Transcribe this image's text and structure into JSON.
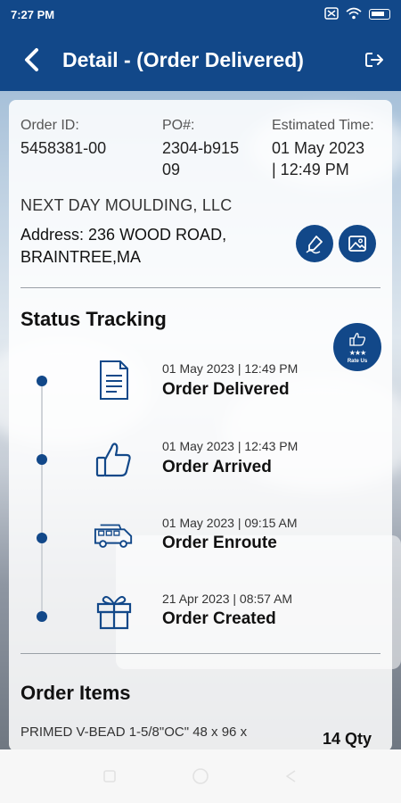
{
  "status_bar": {
    "time": "7:27 PM"
  },
  "app_bar": {
    "title": "Detail - (Order Delivered)"
  },
  "order": {
    "id_label": "Order ID:",
    "id_value": "5458381-00",
    "po_label": "PO#:",
    "po_value_line1": "2304-b915",
    "po_value_line2": "09",
    "eta_label": "Estimated Time:",
    "eta_value_line1": "01 May 2023",
    "eta_value_line2": "| 12:49 PM",
    "company": "NEXT DAY MOULDING, LLC",
    "address_line1": "Address: 236 WOOD ROAD,",
    "address_line2": "BRAINTREE,MA"
  },
  "status_tracking": {
    "title": "Status Tracking",
    "rate_label": "Rate Us",
    "steps": [
      {
        "time": "01 May 2023 | 12:49 PM",
        "title": "Order Delivered",
        "icon": "document-icon"
      },
      {
        "time": "01 May 2023 | 12:43 PM",
        "title": "Order Arrived",
        "icon": "thumbs-up-icon"
      },
      {
        "time": "01 May 2023 | 09:15 AM",
        "title": "Order Enroute",
        "icon": "truck-icon"
      },
      {
        "time": "21 Apr 2023 | 08:57 AM",
        "title": "Order Created",
        "icon": "gift-icon"
      }
    ]
  },
  "order_items": {
    "title": "Order Items",
    "items": [
      {
        "name": "PRIMED V-BEAD 1-5/8\"OC\" 48 x 96 x",
        "qty": "14 Qty"
      }
    ]
  },
  "colors": {
    "primary": "#124889"
  }
}
